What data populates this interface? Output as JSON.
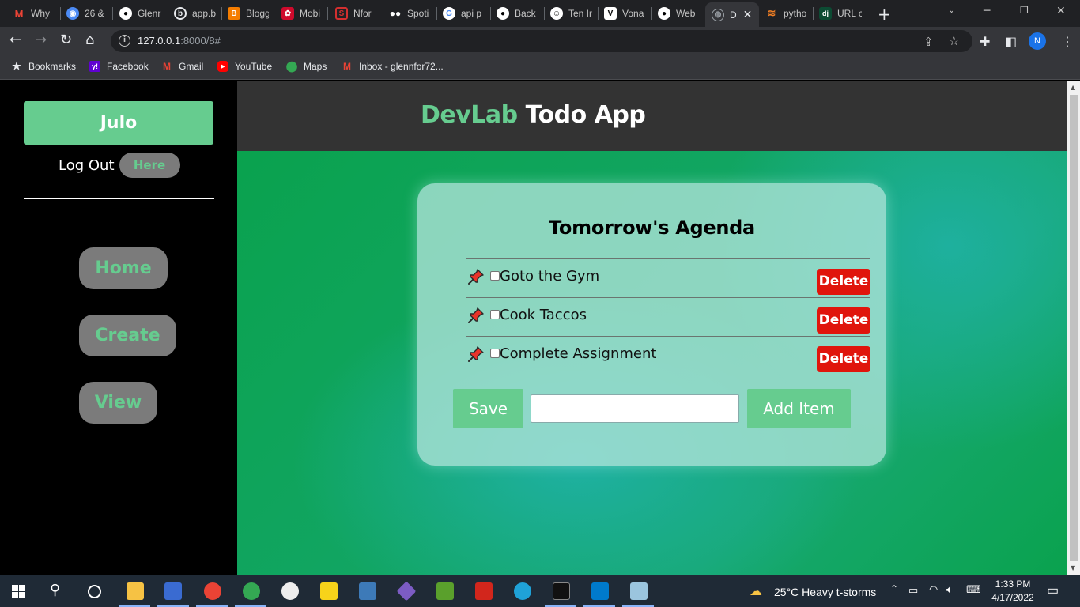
{
  "browser": {
    "tabs": [
      {
        "label": "Why",
        "icon": "gmail-icon",
        "color": "#ea4335"
      },
      {
        "label": "26 &",
        "icon": "app-icon",
        "color": "#4c8bf5"
      },
      {
        "label": "Glenr",
        "icon": "github-icon",
        "color": "#ffffff"
      },
      {
        "label": "app.b",
        "icon": "app-icon",
        "color": "#ffffff"
      },
      {
        "label": "Blogg",
        "icon": "blogger-icon",
        "color": "#f57d00"
      },
      {
        "label": "Mobi",
        "icon": "huawei-icon",
        "color": "#cf0a2c"
      },
      {
        "label": "Nfor",
        "icon": "nforce-icon",
        "color": "#d32f2f"
      },
      {
        "label": "Spoti",
        "icon": "medium-icon",
        "color": "#ffffff"
      },
      {
        "label": "api p",
        "icon": "google-icon",
        "color": "#4285f4"
      },
      {
        "label": "Back",
        "icon": "github-icon",
        "color": "#ffffff"
      },
      {
        "label": "Ten Ir",
        "icon": "app-icon",
        "color": "#ffffff"
      },
      {
        "label": "Vona",
        "icon": "vonage-icon",
        "color": "#ffffff"
      },
      {
        "label": "Web",
        "icon": "github-icon",
        "color": "#ffffff"
      },
      {
        "label": "D",
        "icon": "globe-icon",
        "color": "#9aa0a6",
        "active": true
      },
      {
        "label": "pytho",
        "icon": "stackoverflow-icon",
        "color": "#f48024"
      },
      {
        "label": "URL c",
        "icon": "django-icon",
        "color": "#0c4b33"
      }
    ],
    "url_host": "127.0.0.1",
    "url_path": ":8000/8#",
    "bookmarks": [
      {
        "label": "Bookmarks",
        "icon": "star-icon"
      },
      {
        "label": "Facebook",
        "icon": "yahoo-icon"
      },
      {
        "label": "Gmail",
        "icon": "gmail-icon"
      },
      {
        "label": "YouTube",
        "icon": "youtube-icon"
      },
      {
        "label": "Maps",
        "icon": "maps-icon"
      },
      {
        "label": "Inbox - glennfor72...",
        "icon": "gmail-icon"
      }
    ],
    "profile_initial": "N"
  },
  "sidebar": {
    "user_name": "Julo",
    "logout_label": "Log Out",
    "here_label": "Here",
    "nav": [
      {
        "label": "Home"
      },
      {
        "label": "Create"
      },
      {
        "label": "View"
      }
    ]
  },
  "header": {
    "brand": "DevLab",
    "title_rest": "Todo App"
  },
  "card": {
    "title": "Tomorrow's Agenda",
    "items": [
      {
        "text": "Goto the Gym",
        "delete_label": "Delete",
        "checked": false
      },
      {
        "text": "Cook Taccos",
        "delete_label": "Delete",
        "checked": false
      },
      {
        "text": "Complete Assignment",
        "delete_label": "Delete",
        "checked": false
      }
    ],
    "save_label": "Save",
    "new_item_value": "",
    "add_label": "Add Item"
  },
  "taskbar": {
    "weather": "25°C  Heavy t-storms",
    "time": "1:33 PM",
    "date": "4/17/2022"
  },
  "colors": {
    "accent": "#66cc8f",
    "delete": "#e0150c",
    "header_bg": "#333333"
  }
}
